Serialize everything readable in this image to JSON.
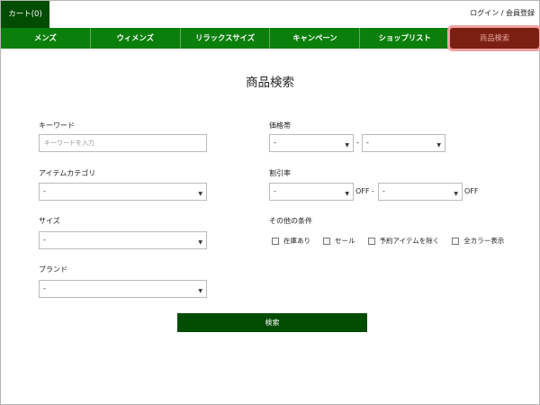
{
  "header": {
    "cart_label": "カート(0)",
    "login_label": "ログイン",
    "divider": "/",
    "register_label": "会員登録"
  },
  "nav": {
    "items": [
      {
        "label": "メンズ"
      },
      {
        "label": "ウィメンズ"
      },
      {
        "label": "リラックスサイズ"
      },
      {
        "label": "キャンペーン"
      },
      {
        "label": "ショップリスト"
      },
      {
        "label": "商品検索"
      }
    ],
    "active_index": 5
  },
  "page_title": "商品検索",
  "form": {
    "keyword": {
      "label": "キーワード",
      "placeholder": "キーワードを入力",
      "value": ""
    },
    "category": {
      "label": "アイテムカテゴリ",
      "value": "-"
    },
    "size": {
      "label": "サイズ",
      "value": "-"
    },
    "brand": {
      "label": "ブランド",
      "value": "-"
    },
    "price": {
      "label": "価格帯",
      "min": "-",
      "separator": "-",
      "max": "-"
    },
    "discount": {
      "label": "割引率",
      "min": "-",
      "off1": "OFF",
      "separator": "-",
      "max": "-",
      "off2": "OFF"
    },
    "other": {
      "label": "その他の条件",
      "options": [
        {
          "label": "在庫あり",
          "checked": false
        },
        {
          "label": "セール",
          "checked": false
        },
        {
          "label": "予約アイテムを除く",
          "checked": false
        },
        {
          "label": "全カラー表示",
          "checked": false
        }
      ]
    },
    "search_button": "検索"
  },
  "colors": {
    "nav_green": "#0b7f0b",
    "dark_green": "#004c00",
    "active_tab": "#7a1f12",
    "highlight": "#f3a1a1"
  }
}
